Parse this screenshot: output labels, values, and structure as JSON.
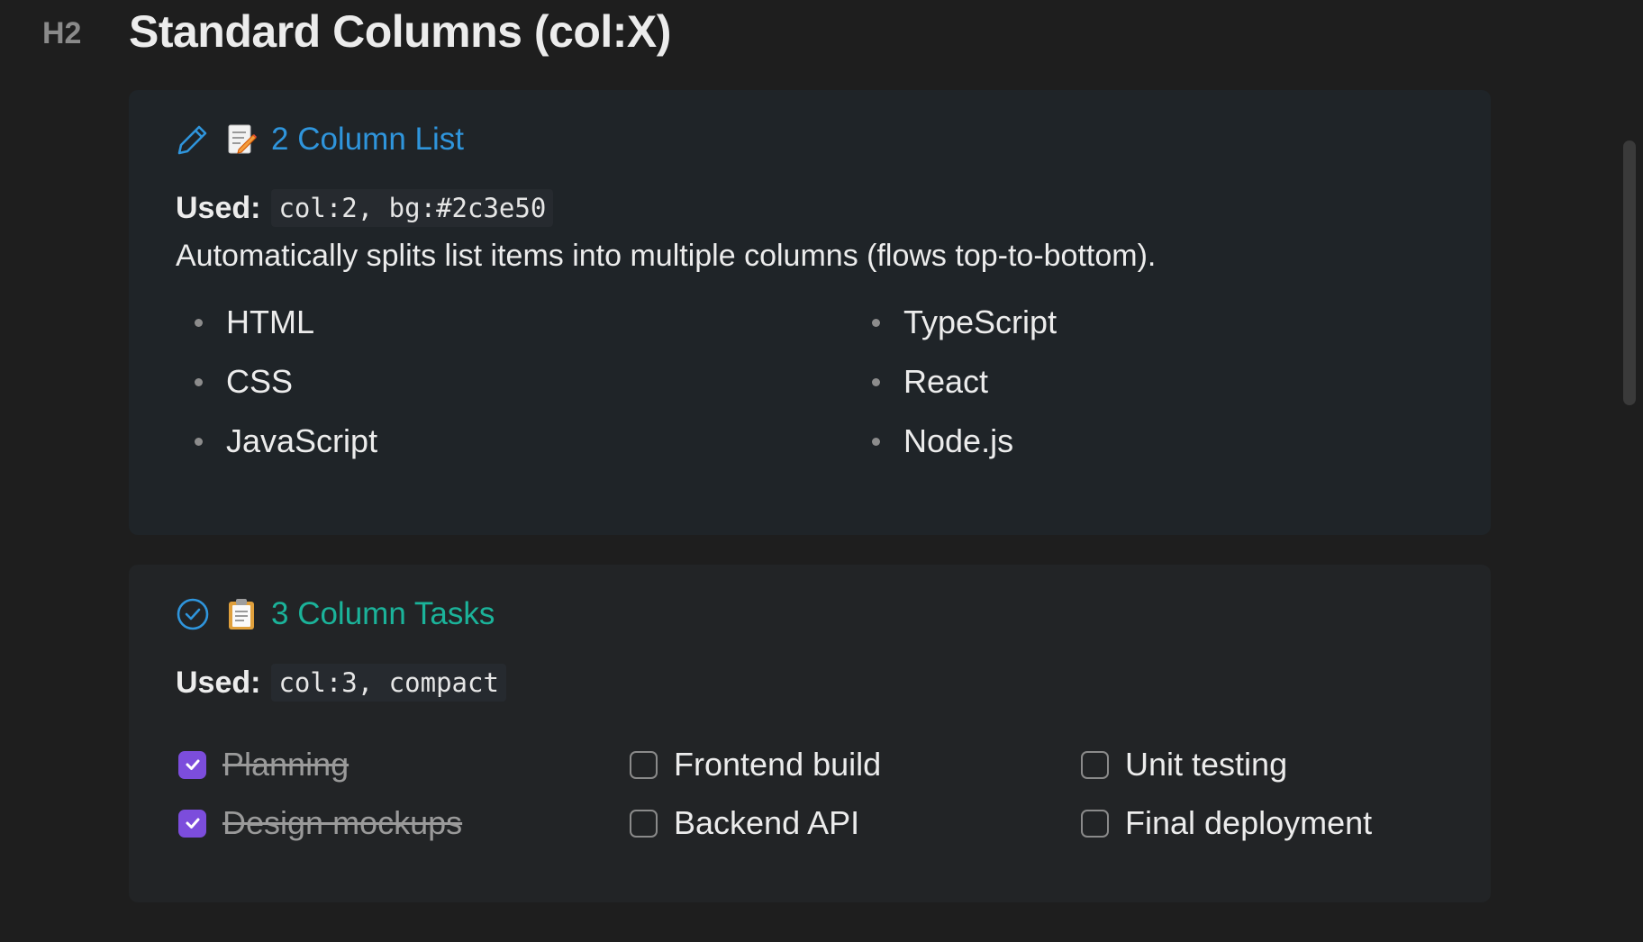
{
  "heading": {
    "level": "H2",
    "title": "Standard Columns (col:X)"
  },
  "callouts": [
    {
      "icon": "pencil-icon",
      "emoji": "memo-icon",
      "title": "2 Column List",
      "title_color": "#2f95dc",
      "used_label": "Used:",
      "used_code": "col:2, bg:#2c3e50",
      "description": "Automatically splits list items into multiple columns (flows top-to-bottom).",
      "list_columns": [
        [
          "HTML",
          "CSS",
          "JavaScript"
        ],
        [
          "TypeScript",
          "React",
          "Node.js"
        ]
      ]
    },
    {
      "icon": "check-circle-icon",
      "emoji": "clipboard-icon",
      "title": "3 Column Tasks",
      "title_color": "#1bb39a",
      "used_label": "Used:",
      "used_code": "col:3, compact",
      "tasks": [
        {
          "label": "Planning",
          "checked": true
        },
        {
          "label": "Design mockups",
          "checked": true
        },
        {
          "label": "Frontend build",
          "checked": false
        },
        {
          "label": "Backend API",
          "checked": false
        },
        {
          "label": "Unit testing",
          "checked": false
        },
        {
          "label": "Final deployment",
          "checked": false
        }
      ]
    }
  ],
  "colors": {
    "background": "#1e1e1e",
    "checkbox_checked": "#7c4ddc"
  }
}
